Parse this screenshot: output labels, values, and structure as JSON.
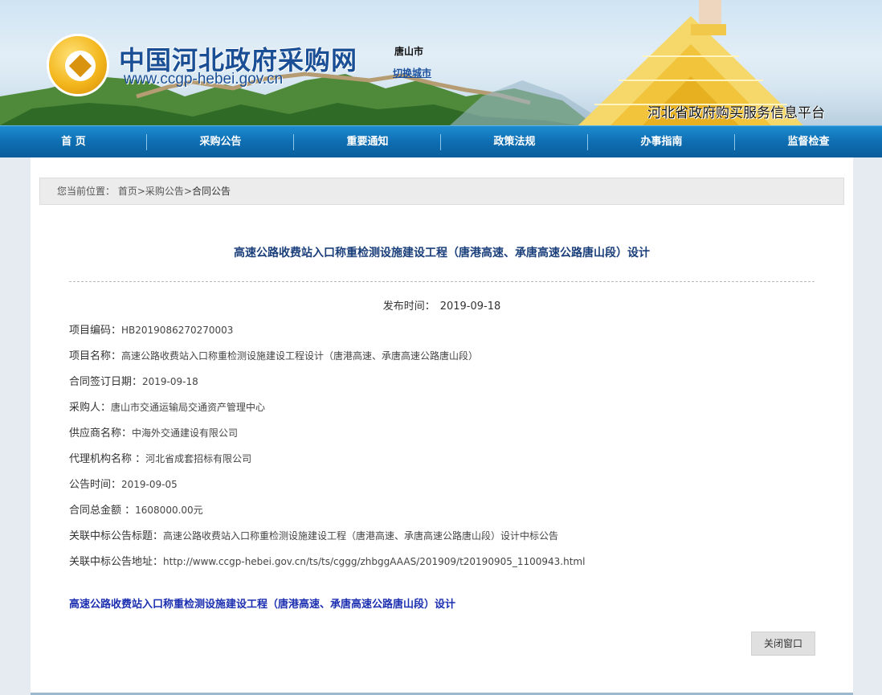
{
  "header": {
    "site_title": "中国河北政府采购网",
    "site_url": "www.ccgp-hebei.gov.cn",
    "city": "唐山市",
    "switch_city": "切换城市",
    "platform": "河北省政府购买服务信息平台"
  },
  "nav": {
    "items": [
      "首 页",
      "采购公告",
      "重要通知",
      "政策法规",
      "办事指南",
      "监督检查"
    ]
  },
  "breadcrumb": {
    "prefix": "您当前位置：",
    "home": "首页",
    "sep1": ">",
    "procurement": "采购公告",
    "sep2": ">",
    "current": "合同公告"
  },
  "article": {
    "title": "高速公路收费站入口称重检测设施建设工程（唐港高速、承唐高速公路唐山段）设计",
    "publish_label": "发布时间：",
    "publish_date": "2019-09-18",
    "fields": [
      {
        "label": "项目编码：",
        "value": "HB2019086270270003"
      },
      {
        "label": "项目名称：",
        "value": "高速公路收费站入口称重检测设施建设工程设计（唐港高速、承唐高速公路唐山段）"
      },
      {
        "label": "合同签订日期：",
        "value": "2019-09-18"
      },
      {
        "label": "采购人：",
        "value": "唐山市交通运输局交通资产管理中心"
      },
      {
        "label": "供应商名称：",
        "value": "中海外交通建设有限公司"
      },
      {
        "label": "代理机构名称 ：",
        "value": "河北省成套招标有限公司"
      },
      {
        "label": "公告时间：",
        "value": "2019-09-05"
      },
      {
        "label": "合同总金额 ：",
        "value": "1608000.00元"
      },
      {
        "label": "关联中标公告标题：",
        "value": "高速公路收费站入口称重检测设施建设工程（唐港高速、承唐高速公路唐山段）设计中标公告"
      },
      {
        "label": "关联中标公告地址：",
        "value": "http://www.ccgp-hebei.gov.cn/ts/ts/cggg/zhbggAAAS/201909/t20190905_1100943.html"
      }
    ],
    "related_link": "高速公路收费站入口称重检测设施建设工程（唐港高速、承唐高速公路唐山段）设计",
    "close_button": "关闭窗口"
  },
  "colors": {
    "nav_blue": "#0f6eb2",
    "title_blue": "#1b4f96",
    "link_blue": "#1b2fb0"
  }
}
